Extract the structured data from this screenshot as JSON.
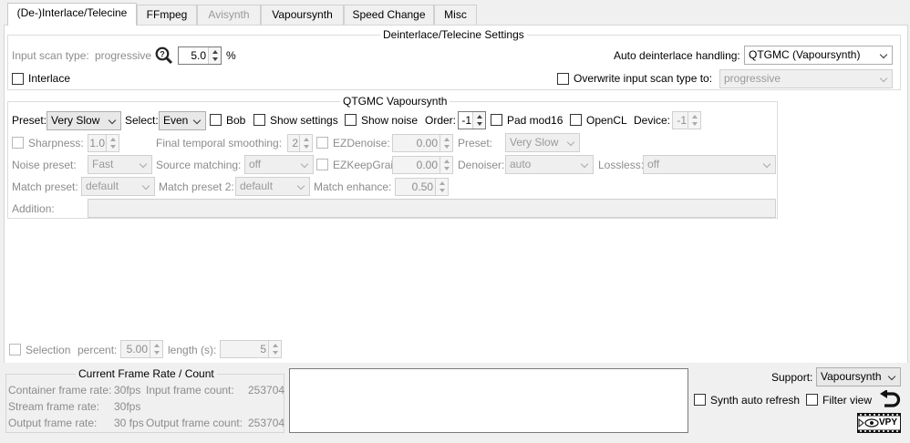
{
  "tabs": [
    {
      "label": "(De-)Interlace/Telecine"
    },
    {
      "label": "FFmpeg"
    },
    {
      "label": "Avisynth"
    },
    {
      "label": "Vapoursynth"
    },
    {
      "label": "Speed Change"
    },
    {
      "label": "Misc"
    }
  ],
  "deint": {
    "title": "Deinterlace/Telecine Settings",
    "input_scan_label": "Input scan type:",
    "input_scan_value": "progressive",
    "percent_value": "5.0",
    "percent_unit": "%",
    "auto_label": "Auto deinterlace handling:",
    "auto_value": "QTGMC (Vapoursynth)",
    "interlace_label": "Interlace",
    "overwrite_label": "Overwrite input scan type to:",
    "overwrite_value": "progressive"
  },
  "qtgmc": {
    "title": "QTGMC Vapoursynth",
    "preset_label": "Preset:",
    "preset_value": "Very Slow",
    "select_label": "Select:",
    "select_value": "Even",
    "bob_label": "Bob",
    "show_settings_label": "Show settings",
    "show_noise_label": "Show noise",
    "order_label": "Order:",
    "order_value": "-1",
    "pad_label": "Pad mod16",
    "opencl_label": "OpenCL",
    "device_label": "Device:",
    "device_value": "-1",
    "sharpness_label": "Sharpness:",
    "sharpness_value": "1.0",
    "fts_label": "Final temporal smoothing:",
    "fts_value": "2",
    "ezdenoise_label": "EZDenoise:",
    "ezdenoise_value": "0.00",
    "preset2_label": "Preset:",
    "preset2_value": "Very Slow",
    "noise_preset_label": "Noise preset:",
    "noise_preset_value": "Fast",
    "source_matching_label": "Source matching:",
    "source_matching_value": "off",
    "ezkeepgrain_label": "EZKeepGrain:",
    "ezkeepgrain_value": "0.00",
    "denoiser_label": "Denoiser:",
    "denoiser_value": "auto",
    "lossless_label": "Lossless:",
    "lossless_value": "off",
    "match_preset_label": "Match preset:",
    "match_preset_value": "default",
    "match_preset2_label": "Match preset 2:",
    "match_preset2_value": "default",
    "match_enhance_label": "Match enhance:",
    "match_enhance_value": "0.50",
    "addition_label": "Addition:",
    "addition_value": ""
  },
  "selection": {
    "label": "Selection",
    "percent_label": "percent:",
    "percent_value": "5.00",
    "length_label": "length (s):",
    "length_value": "5"
  },
  "frame_rate": {
    "title": "Current Frame Rate / Count",
    "container_label": "Container frame rate:",
    "container_value": "30fps",
    "input_count_label": "Input frame count:",
    "input_count_value": "253704",
    "stream_label": "Stream frame rate:",
    "stream_value": "30fps",
    "output_label": "Output frame rate:",
    "output_value": "30 fps",
    "output_count_label": "Output frame count:",
    "output_count_value": "253704"
  },
  "support": {
    "label": "Support:",
    "value": "Vapoursynth",
    "synth_auto_refresh_label": "Synth auto refresh",
    "filter_view_label": "Filter view",
    "vpy_label": "VPY"
  },
  "colors": {
    "panel_bg": "#ffffff",
    "window_bg": "#f0f0f0",
    "disabled_text": "#8c8c8c"
  }
}
